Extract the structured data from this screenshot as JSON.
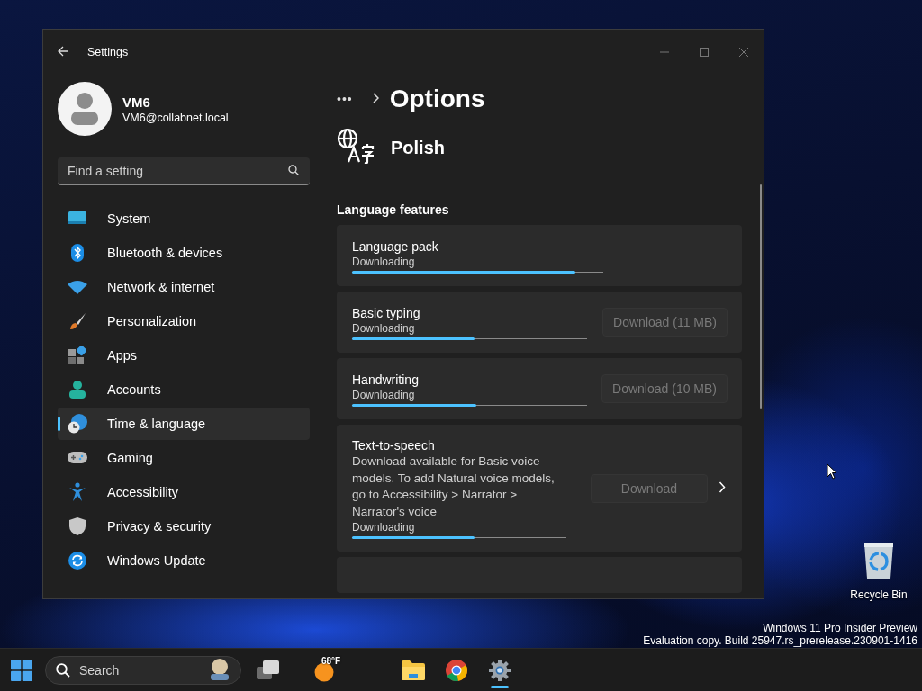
{
  "window": {
    "title": "Settings"
  },
  "profile": {
    "name": "VM6",
    "email": "VM6@collabnet.local"
  },
  "search": {
    "placeholder": "Find a setting"
  },
  "nav": [
    {
      "label": "System",
      "selected": false
    },
    {
      "label": "Bluetooth & devices",
      "selected": false
    },
    {
      "label": "Network & internet",
      "selected": false
    },
    {
      "label": "Personalization",
      "selected": false
    },
    {
      "label": "Apps",
      "selected": false
    },
    {
      "label": "Accounts",
      "selected": false
    },
    {
      "label": "Time & language",
      "selected": true
    },
    {
      "label": "Gaming",
      "selected": false
    },
    {
      "label": "Accessibility",
      "selected": false
    },
    {
      "label": "Privacy & security",
      "selected": false
    },
    {
      "label": "Windows Update",
      "selected": false
    }
  ],
  "breadcrumb": {
    "overflow": "•••",
    "title": "Options"
  },
  "language": {
    "name": "Polish"
  },
  "section_title": "Language features",
  "features": [
    {
      "name": "Language pack",
      "status": "Downloading",
      "level": 0.89
    },
    {
      "name": "Basic typing",
      "status": "Downloading",
      "level": 0.52,
      "button": {
        "label": "Download (11 MB)",
        "disabled": true
      }
    },
    {
      "name": "Handwriting",
      "status": "Downloading",
      "level": 0.53,
      "button": {
        "label": "Download (10 MB)",
        "disabled": true
      }
    },
    {
      "name": "Text-to-speech",
      "description": "Download available for Basic voice models. To add Natural voice models, go to Accessibility > Narrator > Narrator's voice",
      "status": "Downloading",
      "level": 0.57,
      "button": {
        "label": "Download",
        "disabled": true
      },
      "expandable": true
    }
  ],
  "desktop_icons": [
    {
      "label": "Recycle Bin"
    }
  ],
  "watermark": [
    "Windows 11 Pro Insider Preview",
    "Evaluation copy. Build 25947.rs_prerelease.230901-1416"
  ],
  "taskbar": {
    "search_placeholder": "Search",
    "weather": "68°F",
    "apps": [
      {
        "kind": "folder",
        "active": false
      },
      {
        "kind": "browser",
        "active": false
      },
      {
        "kind": "settings",
        "active": true
      }
    ]
  }
}
